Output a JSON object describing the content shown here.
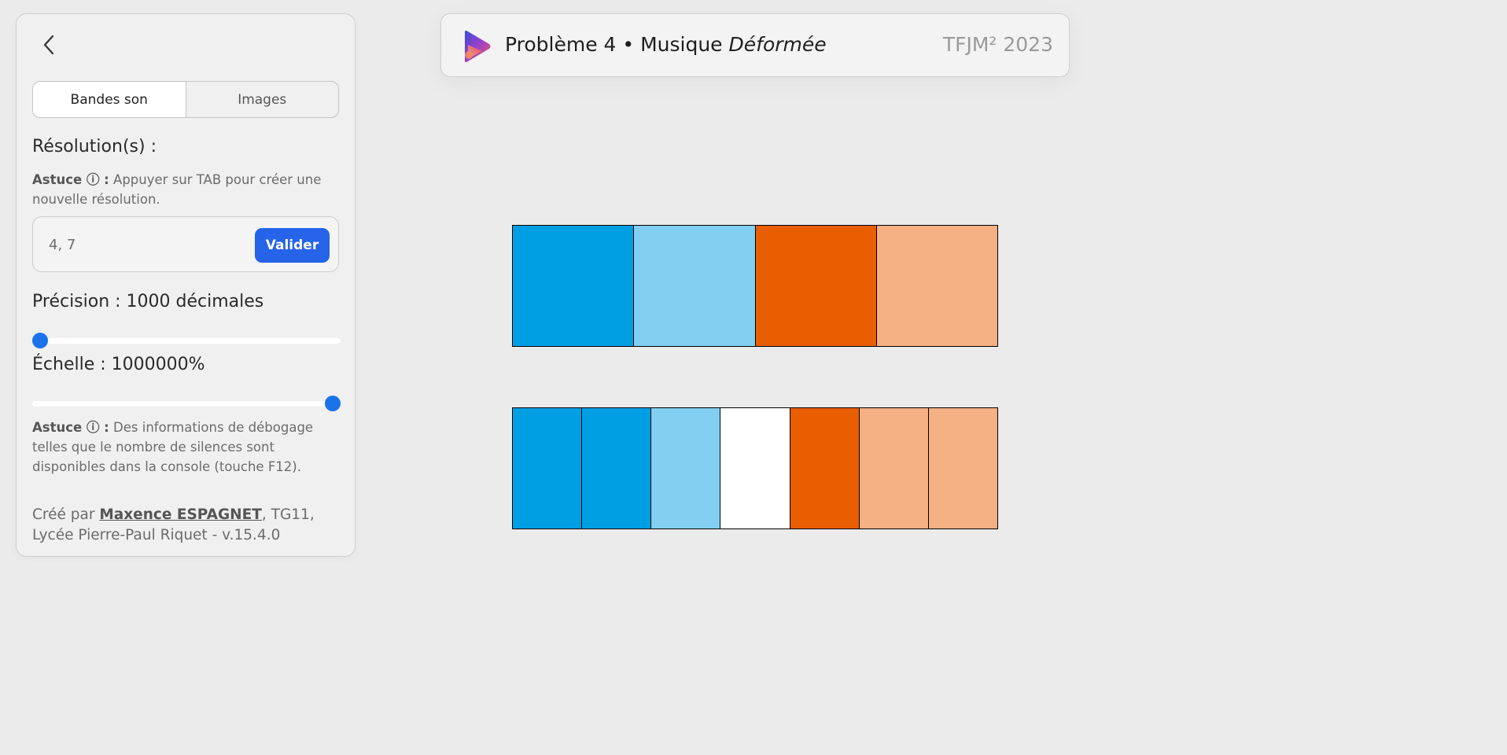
{
  "sidebar": {
    "tabs": [
      {
        "label": "Bandes son",
        "active": true
      },
      {
        "label": "Images",
        "active": false
      }
    ],
    "resolutions": {
      "title": "Résolution(s) :",
      "tip_label": "Astuce ⓘ :",
      "tip_text": " Appuyer sur TAB pour créer une nouvelle résolution.",
      "input_value": "4, 7",
      "validate_label": "Valider"
    },
    "precision": {
      "title": "Précision : 1000 décimales",
      "slider_fraction": 0.0
    },
    "scale": {
      "title": "Échelle : 1000000%",
      "slider_fraction": 1.0
    },
    "debug_tip": {
      "label": "Astuce ⓘ :",
      "text": " Des informations de débogage telles que le nombre de silences sont disponibles dans la console (touche F12)."
    },
    "footer": {
      "prefix": "Créé par ",
      "author": "Maxence ESPAGNET",
      "suffix": ", TG11, Lycée Pierre-Paul Riquet - v.15.4.0"
    }
  },
  "header": {
    "title_plain": "Problème 4 • Musique ",
    "title_italic": "Déformée",
    "right_text": "TFJM² 2023",
    "logo_icon": "play-triangle-logo-icon"
  },
  "colors": {
    "accent": "#2563e8",
    "slider_thumb": "#1a73e8",
    "band_blue": "#009fe3",
    "band_light_blue": "#82cff2",
    "band_orange": "#e85e00",
    "band_peach": "#f5b084",
    "band_white": "#ffffff"
  },
  "bands": [
    {
      "resolution": 4,
      "cells": [
        "#009fe3",
        "#82cff2",
        "#e85e00",
        "#f5b084"
      ]
    },
    {
      "resolution": 7,
      "cells": [
        "#009fe3",
        "#009fe3",
        "#82cff2",
        "#ffffff",
        "#e85e00",
        "#f5b084",
        "#f5b084"
      ]
    }
  ]
}
